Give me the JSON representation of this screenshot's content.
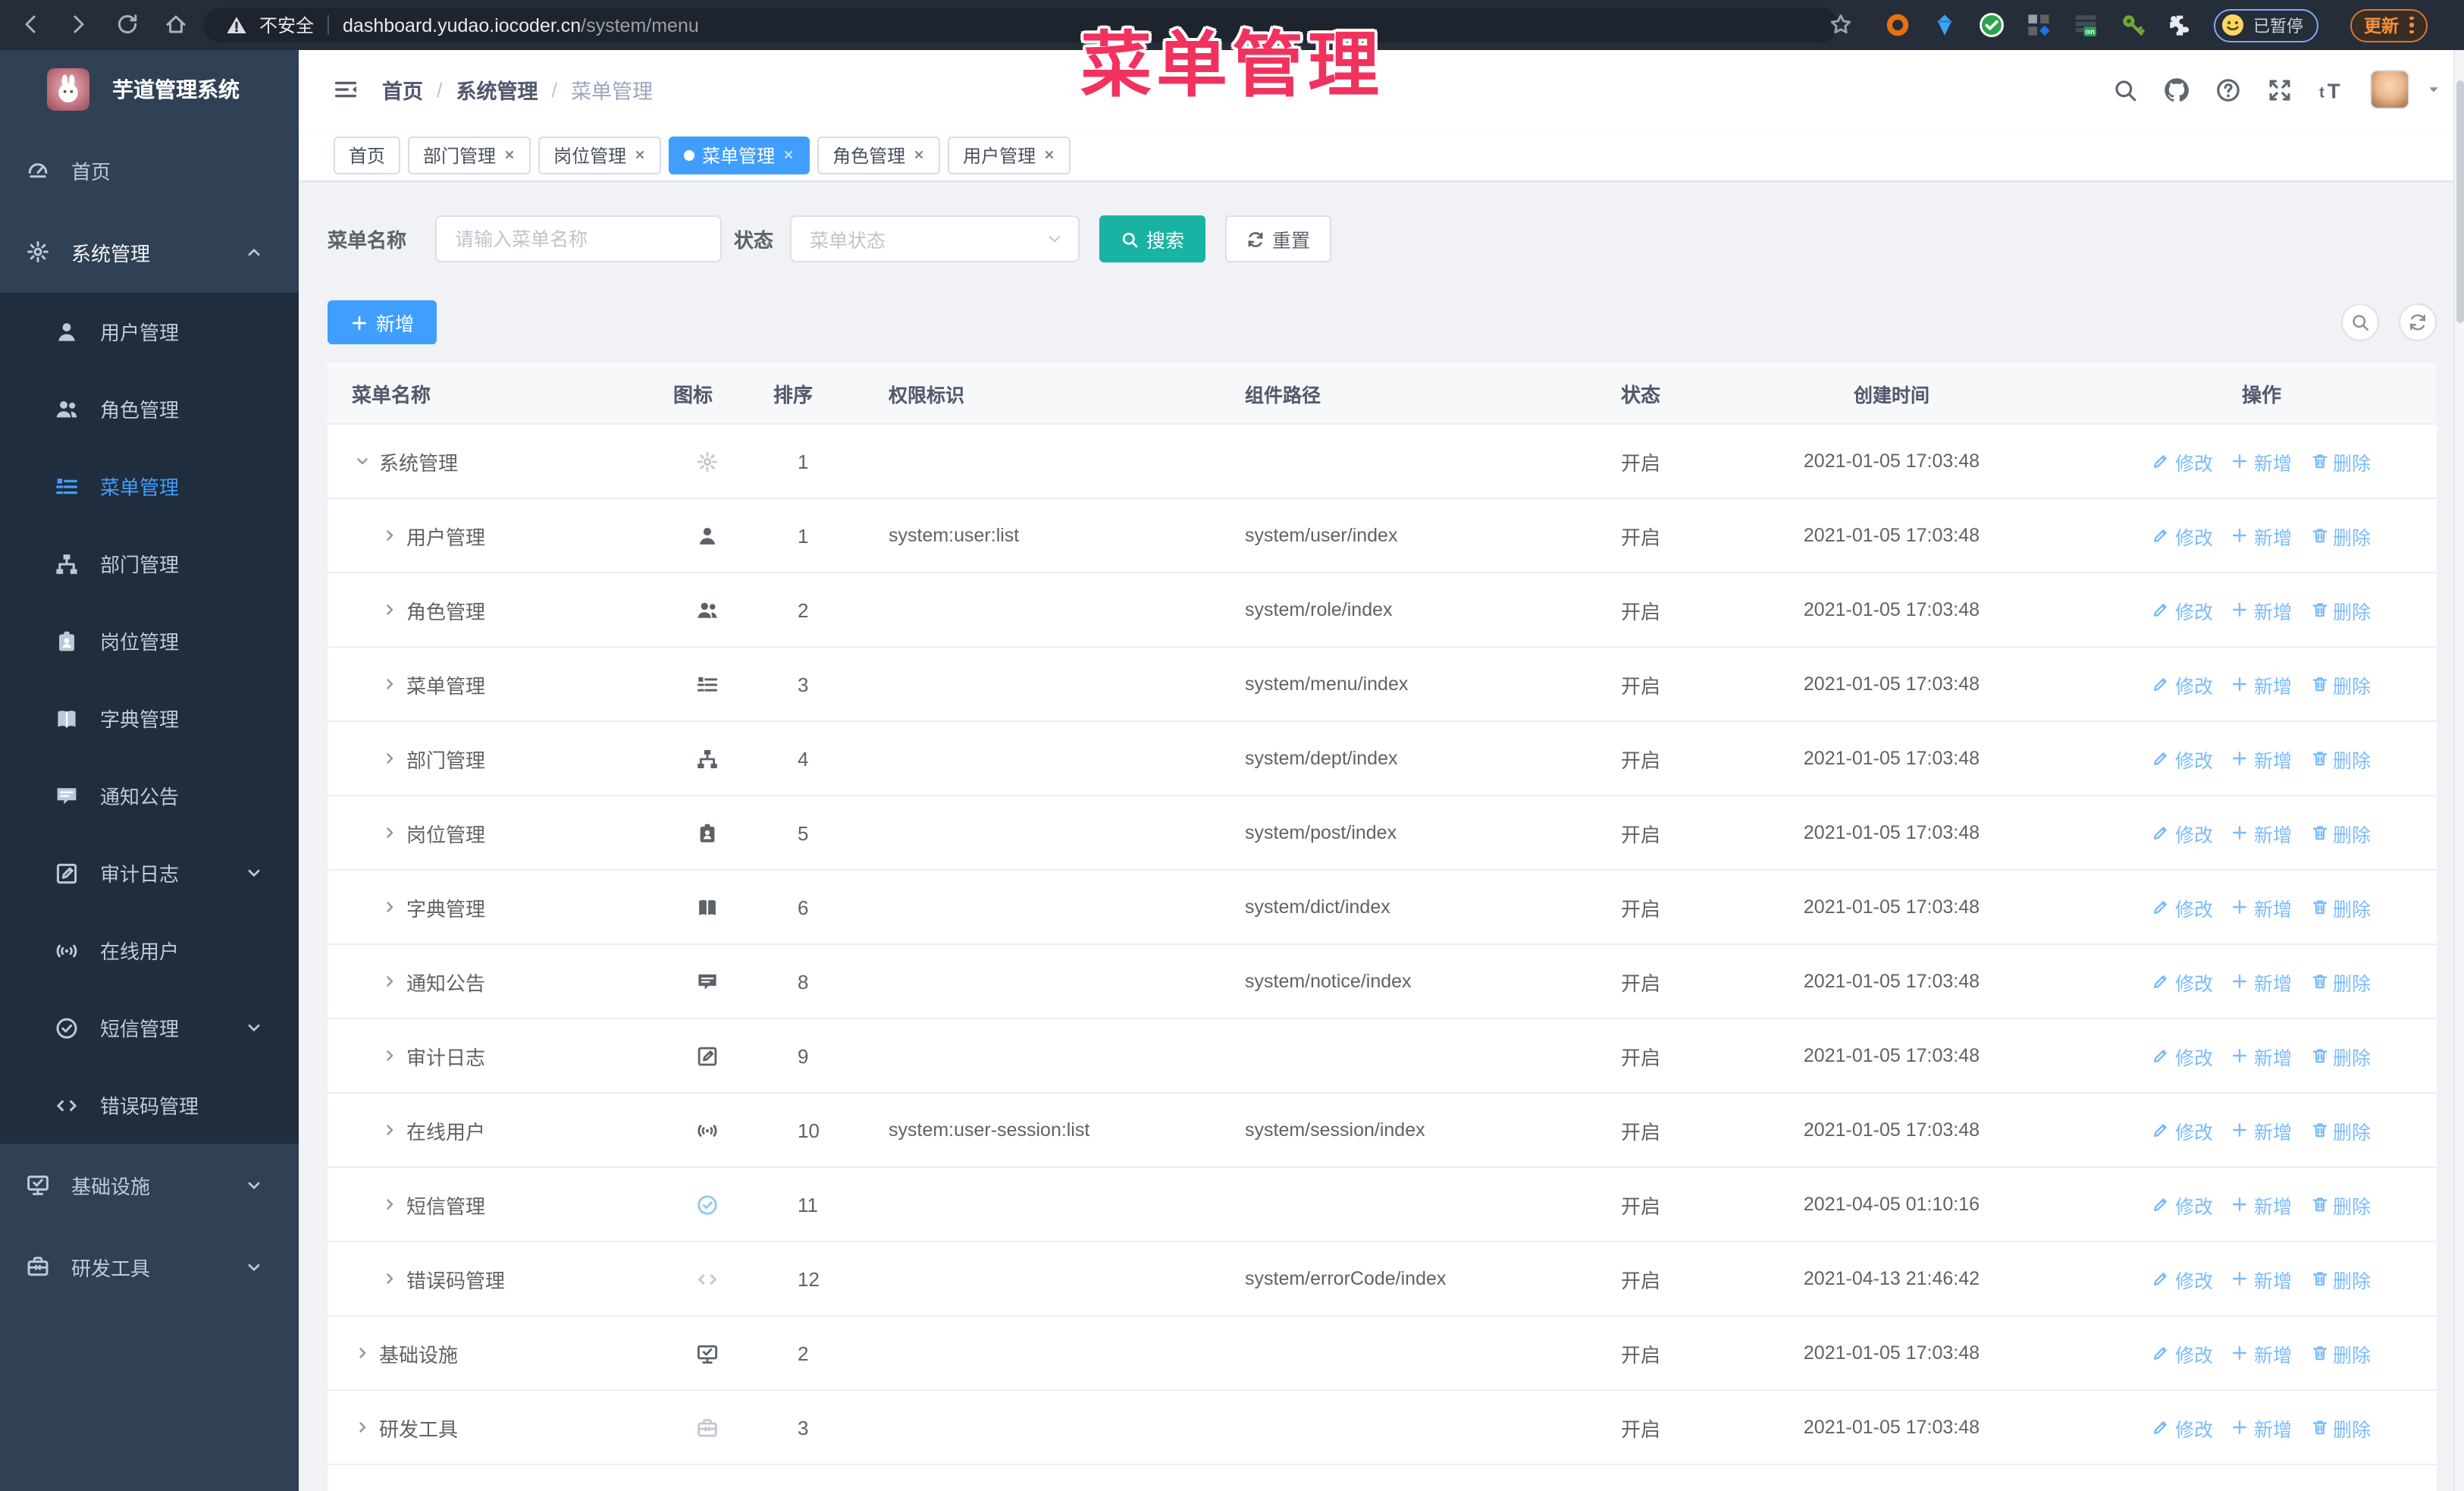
{
  "overlay_title": "菜单管理",
  "browser": {
    "nav_icons": [
      "back-icon",
      "forward-icon",
      "reload-icon",
      "home-icon"
    ],
    "security_label": "不安全",
    "url_host": "dashboard.yudao.iocoder.cn",
    "url_path": "/system/menu",
    "bookmark_icon": "star-icon",
    "extension_icons": [
      "ring-extension-icon",
      "gem-extension-icon",
      "check-extension-icon",
      "grid-extension-icon",
      "stack-on-extension-icon",
      "key-extension-icon",
      "puzzle-extension-icon"
    ],
    "paused_badge": "已暂停",
    "update_button": "更新"
  },
  "sidebar": {
    "logo_title": "芋道管理系统",
    "items": [
      {
        "label": "首页",
        "icon": "dashboard-icon",
        "level": 0,
        "chevron": null,
        "active": false
      },
      {
        "label": "系统管理",
        "icon": "gear-icon",
        "level": 0,
        "chevron": "up",
        "active": false,
        "open": true
      },
      {
        "label": "用户管理",
        "icon": "user-icon",
        "level": 1,
        "chevron": null,
        "active": false
      },
      {
        "label": "角色管理",
        "icon": "users-icon",
        "level": 1,
        "chevron": null,
        "active": false
      },
      {
        "label": "菜单管理",
        "icon": "menu-icon",
        "level": 1,
        "chevron": null,
        "active": true
      },
      {
        "label": "部门管理",
        "icon": "org-tree-icon",
        "level": 1,
        "chevron": null,
        "active": false
      },
      {
        "label": "岗位管理",
        "icon": "badge-icon",
        "level": 1,
        "chevron": null,
        "active": false
      },
      {
        "label": "字典管理",
        "icon": "book-icon",
        "level": 1,
        "chevron": null,
        "active": false
      },
      {
        "label": "通知公告",
        "icon": "message-icon",
        "level": 1,
        "chevron": null,
        "active": false
      },
      {
        "label": "审计日志",
        "icon": "edit-log-icon",
        "level": 1,
        "chevron": "down",
        "active": false
      },
      {
        "label": "在线用户",
        "icon": "online-icon",
        "level": 1,
        "chevron": null,
        "active": false
      },
      {
        "label": "短信管理",
        "icon": "check-badge-icon",
        "level": 1,
        "chevron": "down",
        "active": false
      },
      {
        "label": "错误码管理",
        "icon": "code-icon",
        "level": 1,
        "chevron": null,
        "active": false
      },
      {
        "label": "基础设施",
        "icon": "infra-icon",
        "level": 0,
        "chevron": "down",
        "active": false
      },
      {
        "label": "研发工具",
        "icon": "toolbox-icon",
        "level": 0,
        "chevron": "down",
        "active": false
      }
    ]
  },
  "header": {
    "breadcrumb": [
      "首页",
      "系统管理",
      "菜单管理"
    ],
    "icons": [
      "search-icon",
      "github-icon",
      "help-icon",
      "fullscreen-icon",
      "font-size-icon"
    ]
  },
  "tabs": [
    {
      "label": "首页",
      "closable": false,
      "active": false
    },
    {
      "label": "部门管理",
      "closable": true,
      "active": false
    },
    {
      "label": "岗位管理",
      "closable": true,
      "active": false
    },
    {
      "label": "菜单管理",
      "closable": true,
      "active": true
    },
    {
      "label": "角色管理",
      "closable": true,
      "active": false
    },
    {
      "label": "用户管理",
      "closable": true,
      "active": false
    }
  ],
  "filters": {
    "name_label": "菜单名称",
    "name_placeholder": "请输入菜单名称",
    "status_label": "状态",
    "status_placeholder": "菜单状态",
    "search_button": "搜索",
    "reset_button": "重置"
  },
  "toolbar": {
    "add_button": "新增"
  },
  "table": {
    "columns": [
      "菜单名称",
      "图标",
      "排序",
      "权限标识",
      "组件路径",
      "状态",
      "创建时间",
      "操作"
    ],
    "op_labels": {
      "edit": "修改",
      "add": "新增",
      "delete": "删除"
    },
    "rows": [
      {
        "name": "系统管理",
        "icon": "gear-icon",
        "level": 0,
        "expanded": true,
        "sort": "1",
        "perm": "",
        "path": "",
        "status": "开启",
        "created": "2021-01-05 17:03:48"
      },
      {
        "name": "用户管理",
        "icon": "user-icon",
        "level": 1,
        "expanded": false,
        "sort": "1",
        "perm": "system:user:list",
        "path": "system/user/index",
        "status": "开启",
        "created": "2021-01-05 17:03:48"
      },
      {
        "name": "角色管理",
        "icon": "users-icon",
        "level": 1,
        "expanded": false,
        "sort": "2",
        "perm": "",
        "path": "system/role/index",
        "status": "开启",
        "created": "2021-01-05 17:03:48"
      },
      {
        "name": "菜单管理",
        "icon": "menu-icon",
        "level": 1,
        "expanded": false,
        "sort": "3",
        "perm": "",
        "path": "system/menu/index",
        "status": "开启",
        "created": "2021-01-05 17:03:48"
      },
      {
        "name": "部门管理",
        "icon": "org-tree-icon",
        "level": 1,
        "expanded": false,
        "sort": "4",
        "perm": "",
        "path": "system/dept/index",
        "status": "开启",
        "created": "2021-01-05 17:03:48"
      },
      {
        "name": "岗位管理",
        "icon": "badge-icon",
        "level": 1,
        "expanded": false,
        "sort": "5",
        "perm": "",
        "path": "system/post/index",
        "status": "开启",
        "created": "2021-01-05 17:03:48"
      },
      {
        "name": "字典管理",
        "icon": "book-icon",
        "level": 1,
        "expanded": false,
        "sort": "6",
        "perm": "",
        "path": "system/dict/index",
        "status": "开启",
        "created": "2021-01-05 17:03:48"
      },
      {
        "name": "通知公告",
        "icon": "message-icon",
        "level": 1,
        "expanded": false,
        "sort": "8",
        "perm": "",
        "path": "system/notice/index",
        "status": "开启",
        "created": "2021-01-05 17:03:48"
      },
      {
        "name": "审计日志",
        "icon": "edit-log-icon",
        "level": 1,
        "expanded": false,
        "sort": "9",
        "perm": "",
        "path": "",
        "status": "开启",
        "created": "2021-01-05 17:03:48"
      },
      {
        "name": "在线用户",
        "icon": "online-icon",
        "level": 1,
        "expanded": false,
        "sort": "10",
        "perm": "system:user-session:list",
        "path": "system/session/index",
        "status": "开启",
        "created": "2021-01-05 17:03:48"
      },
      {
        "name": "短信管理",
        "icon": "check-badge-icon",
        "level": 1,
        "expanded": false,
        "sort": "11",
        "perm": "",
        "path": "",
        "status": "开启",
        "created": "2021-04-05 01:10:16"
      },
      {
        "name": "错误码管理",
        "icon": "code-icon",
        "level": 1,
        "expanded": false,
        "sort": "12",
        "perm": "",
        "path": "system/errorCode/index",
        "status": "开启",
        "created": "2021-04-13 21:46:42"
      },
      {
        "name": "基础设施",
        "icon": "infra-icon",
        "level": 0,
        "expanded": false,
        "sort": "2",
        "perm": "",
        "path": "",
        "status": "开启",
        "created": "2021-01-05 17:03:48"
      },
      {
        "name": "研发工具",
        "icon": "toolbox-icon",
        "level": 0,
        "expanded": false,
        "sort": "3",
        "perm": "",
        "path": "",
        "status": "开启",
        "created": "2021-01-05 17:03:48"
      }
    ]
  },
  "colors": {
    "accent": "#409eff",
    "search_button": "#18b3a3",
    "op_link": "#79bbff",
    "sidebar_bg": "#304156",
    "submenu_bg": "#1f2d3d",
    "overlay_text": "#f1325e",
    "browser_bar": "#252d38"
  }
}
